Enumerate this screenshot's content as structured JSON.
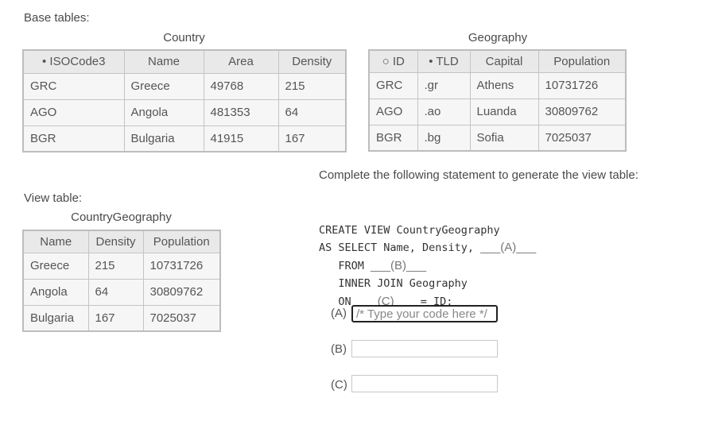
{
  "base_label": "Base tables:",
  "country": {
    "caption": "Country",
    "headers": [
      "• ISOCode3",
      "Name",
      "Area",
      "Density"
    ],
    "rows": [
      [
        "GRC",
        "Greece",
        "49768",
        "215"
      ],
      [
        "AGO",
        "Angola",
        "481353",
        "64"
      ],
      [
        "BGR",
        "Bulgaria",
        "41915",
        "167"
      ]
    ]
  },
  "geography": {
    "caption": "Geography",
    "headers": [
      "○ ID",
      "• TLD",
      "Capital",
      "Population"
    ],
    "rows": [
      [
        "GRC",
        ".gr",
        "Athens",
        "10731726"
      ],
      [
        "AGO",
        ".ao",
        "Luanda",
        "30809762"
      ],
      [
        "BGR",
        ".bg",
        "Sofia",
        "7025037"
      ]
    ]
  },
  "view_label": "View table:",
  "countrygeography": {
    "caption": "CountryGeography",
    "headers": [
      "Name",
      "Density",
      "Population"
    ],
    "rows": [
      [
        "Greece",
        "215",
        "10731726"
      ],
      [
        "Angola",
        "64",
        "30809762"
      ],
      [
        "Bulgaria",
        "167",
        "7025037"
      ]
    ]
  },
  "instruction": "Complete the following statement to generate the view table:",
  "code": {
    "line1": "CREATE VIEW CountryGeography",
    "line2_prefix": "AS SELECT Name, Density, ",
    "blank_a": "___(A)___",
    "line3_prefix": "   FROM ",
    "blank_b": "___(B)___",
    "line4": "   INNER JOIN Geography",
    "line5_prefix": "   ON ",
    "blank_c": "___(C)___",
    "line5_suffix": " = ID;"
  },
  "answers": {
    "a_label": "(A)",
    "a_placeholder": "/* Type your code here */",
    "b_label": "(B)",
    "c_label": "(C)"
  }
}
